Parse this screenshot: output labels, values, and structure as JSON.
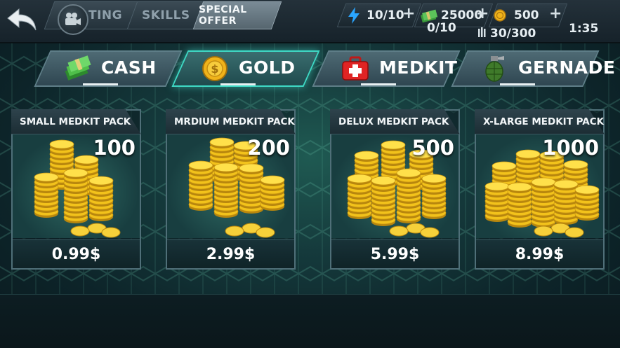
{
  "top_tabs": [
    {
      "label": "TING"
    },
    {
      "label": "SKILLS"
    },
    {
      "label": "SPECIAL OFFER"
    }
  ],
  "resources": {
    "energy": "10/10",
    "cash": "25000",
    "cash_sub": "0/10",
    "gold": "500",
    "ammo": "30/300",
    "timer": "1:35",
    "plus": "+"
  },
  "categories": [
    {
      "label": "CASH",
      "icon": "cash-stack-icon"
    },
    {
      "label": "GOLD",
      "icon": "gold-coin-icon"
    },
    {
      "label": "MEDKIT",
      "icon": "medkit-icon"
    },
    {
      "label": "GERNADE",
      "icon": "grenade-icon"
    }
  ],
  "active_category": "GOLD",
  "packs": [
    {
      "title": "SMALL MEDKIT PACK",
      "amount": "100",
      "price": "0.99$"
    },
    {
      "title": "MRDIUM MEDKIT PACK",
      "amount": "200",
      "price": "2.99$"
    },
    {
      "title": "DELUX MEDKIT PACK",
      "amount": "500",
      "price": "5.99$"
    },
    {
      "title": "X-LARGE MEDKIT PACK",
      "amount": "1000",
      "price": "8.99$"
    }
  ],
  "colors": {
    "accent": "#3fd9c5",
    "gold": "#f2c21b",
    "panel": "#1c2d34"
  }
}
